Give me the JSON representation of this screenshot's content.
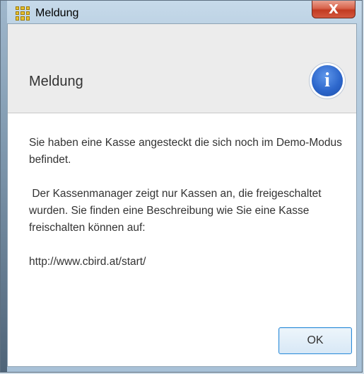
{
  "window": {
    "title": "Meldung",
    "close_label": "X"
  },
  "dialog": {
    "header_title": "Meldung",
    "info_icon_glyph": "i",
    "message": {
      "paragraph1": "Sie haben eine Kasse angesteckt die sich noch im Demo-Modus befindet.",
      "paragraph2": " Der Kassenmanager zeigt nur Kassen an, die freigeschaltet wurden. Sie finden eine Beschreibung wie Sie eine Kasse freischalten können auf:",
      "link": "http://www.cbird.at/start/"
    },
    "ok_label": "OK"
  },
  "colors": {
    "accent": "#2b8bd8",
    "info_icon": "#2d67cc",
    "close_button": "#c23b22",
    "header_bg": "#ececec"
  },
  "icons": {
    "app": "grid-app-icon",
    "close": "close-icon",
    "info": "info-icon"
  }
}
